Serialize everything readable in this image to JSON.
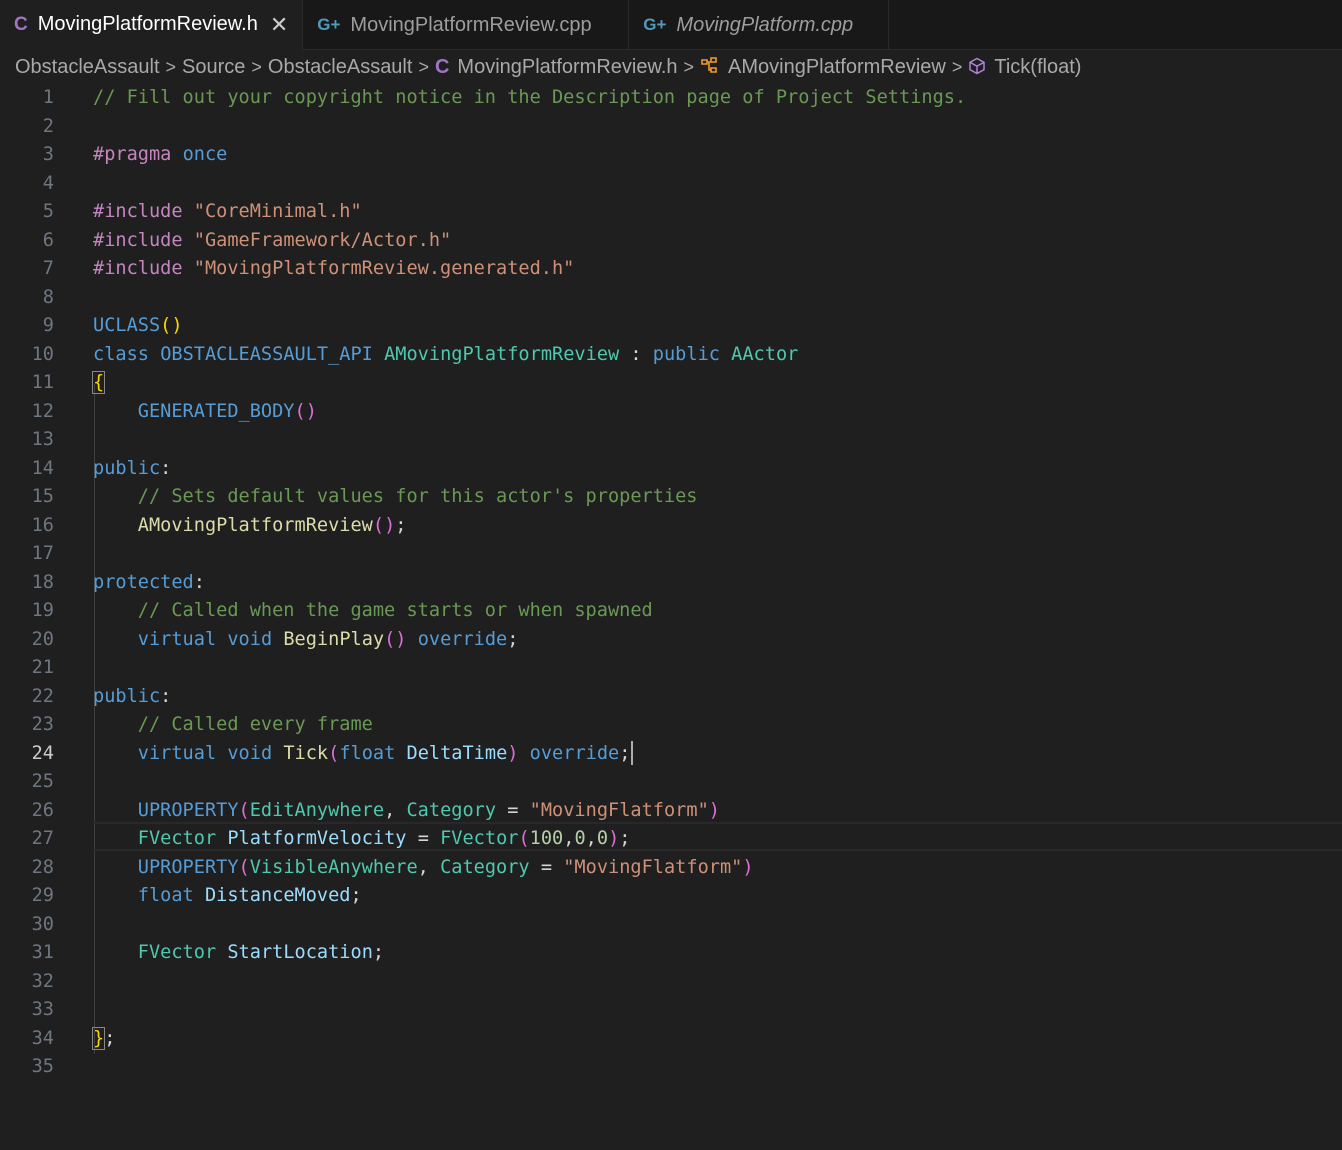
{
  "tabs": [
    {
      "label": "MovingPlatformReview.h",
      "icon": "C",
      "active": true,
      "close": "✕"
    },
    {
      "label": "MovingPlatformReview.cpp",
      "icon": "G+"
    },
    {
      "label": "MovingPlatform.cpp",
      "icon": "G+",
      "italic": true
    }
  ],
  "breadcrumb": {
    "items": [
      "ObstacleAssault",
      "Source",
      "ObstacleAssault",
      "MovingPlatformReview.h",
      "AMovingPlatformReview",
      "Tick(float)"
    ],
    "separator": ">",
    "file_icon": "C"
  },
  "editor": {
    "current_line": 24,
    "line_numbers": [
      "1",
      "2",
      "3",
      "4",
      "5",
      "6",
      "7",
      "8",
      "9",
      "10",
      "11",
      "12",
      "13",
      "14",
      "15",
      "16",
      "17",
      "18",
      "19",
      "20",
      "21",
      "22",
      "23",
      "24",
      "25",
      "26",
      "27",
      "28",
      "29",
      "30",
      "31",
      "32",
      "33",
      "34",
      "35"
    ],
    "lines": [
      "// Fill out your copyright notice in the Description page of Project Settings.",
      "",
      "#pragma once",
      "",
      "#include \"CoreMinimal.h\"",
      "#include \"GameFramework/Actor.h\"",
      "#include \"MovingPlatformReview.generated.h\"",
      "",
      "UCLASS()",
      "class OBSTACLEASSAULT_API AMovingPlatformReview : public AActor",
      "{",
      "    GENERATED_BODY()",
      "",
      "public:",
      "    // Sets default values for this actor's properties",
      "    AMovingPlatformReview();",
      "",
      "protected:",
      "    // Called when the game starts or when spawned",
      "    virtual void BeginPlay() override;",
      "",
      "public:",
      "    // Called every frame",
      "    virtual void Tick(float DeltaTime) override;",
      "",
      "    UPROPERTY(EditAnywhere, Category = \"MovingFlatform\")",
      "    FVector PlatformVelocity = FVector(100,0,0);",
      "    UPROPERTY(VisibleAnywhere, Category = \"MovingFlatform\")",
      "    float DistanceMoved;",
      "",
      "    FVector StartLocation;",
      "",
      "",
      "};",
      ""
    ]
  },
  "colors": {
    "background": "#1f1f1f",
    "comment": "#6a9955",
    "keyword": "#569cd6",
    "type": "#4ec9b0",
    "function": "#dcdcaa",
    "string": "#ce9178",
    "variable": "#9cdcfe",
    "preprocessor": "#c586c0"
  }
}
